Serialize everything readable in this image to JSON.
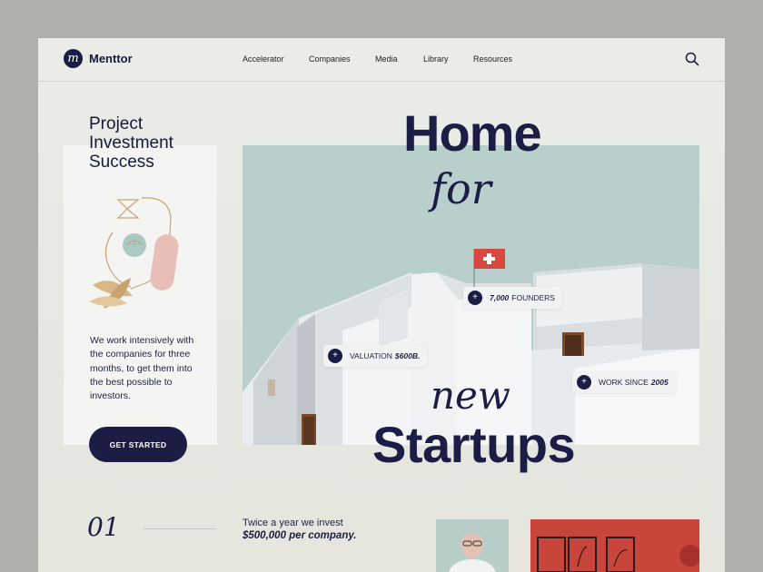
{
  "brand": {
    "mark": "m",
    "name": "Menttor"
  },
  "nav": {
    "items": [
      "Accelerator",
      "Companies",
      "Media",
      "Library",
      "Resources"
    ]
  },
  "headline": [
    "Project",
    "Investment",
    "Success"
  ],
  "description": "We work intensively with the companies for three months, to get them into the best possible to investors.",
  "cta": "GET STARTED",
  "hero": {
    "home": "Home",
    "for": "for",
    "new": "new",
    "startups": "Startups"
  },
  "stats": {
    "founders": {
      "value": "7,000",
      "label": "FOUNDERS"
    },
    "valuation": {
      "label": "VALUATION",
      "value": "$600B."
    },
    "since": {
      "label": "WORK SINCE",
      "value": "2005"
    }
  },
  "section": {
    "number": "01",
    "line1": "Twice a year we invest",
    "line2": "$500,000 per company."
  },
  "colors": {
    "navy": "#1b1d45",
    "sky": "#b8cfcb",
    "red": "#c8453c",
    "flag": "#d9473f"
  }
}
